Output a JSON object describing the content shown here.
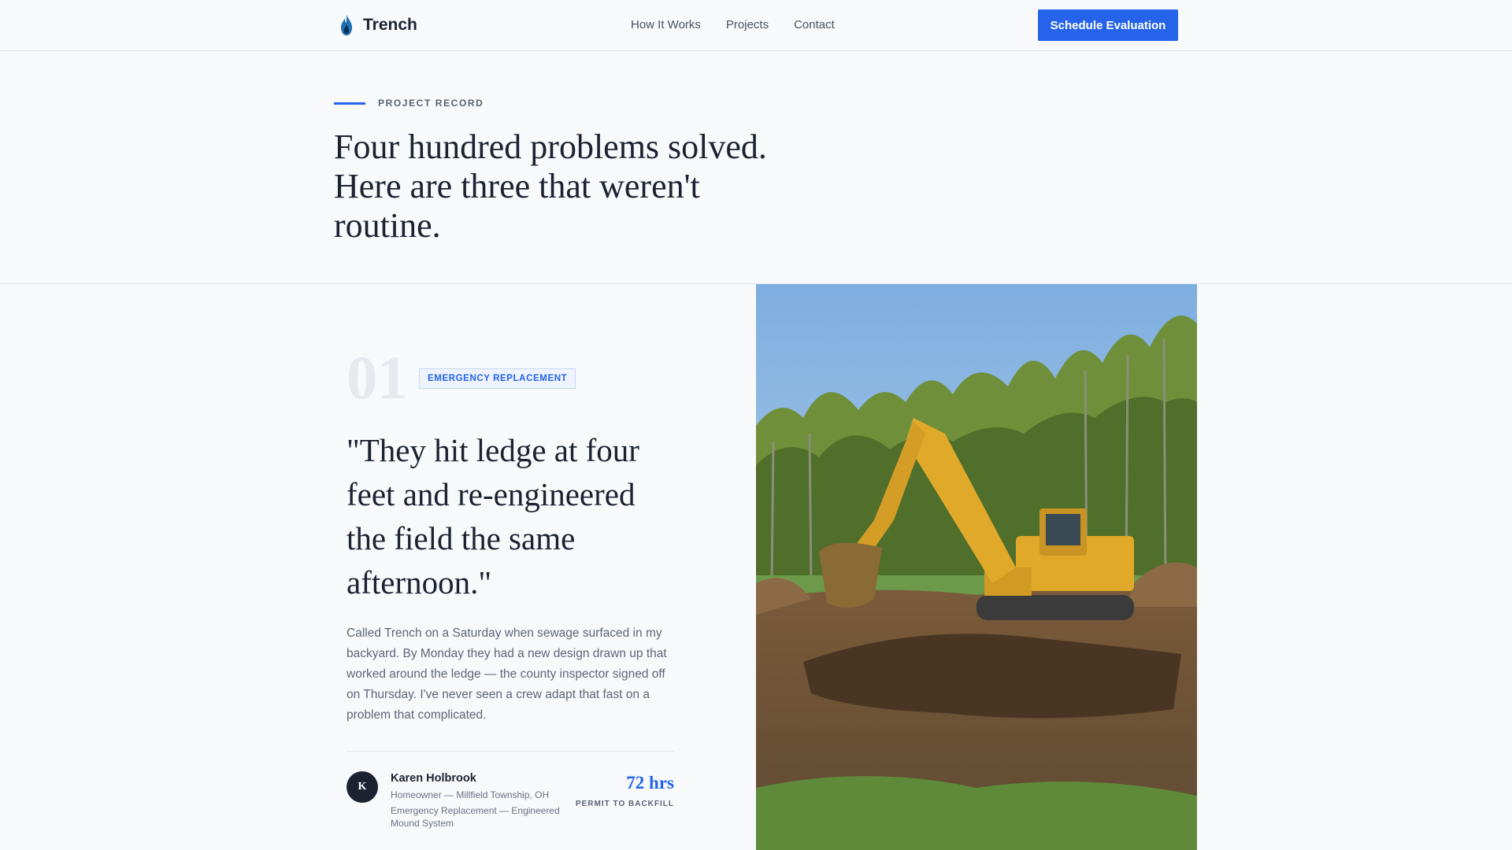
{
  "nav": {
    "brand": "Trench",
    "links": [
      "How It Works",
      "Projects",
      "Contact"
    ],
    "cta": "Schedule Evaluation"
  },
  "hero": {
    "eyebrow": "PROJECT RECORD",
    "title": "Four hundred problems solved. Here are three that weren't routine."
  },
  "case": {
    "number": "01",
    "tag": "EMERGENCY REPLACEMENT",
    "quote": "\"They hit ledge at four feet and re-engineered the field the same afternoon.\"",
    "body": "Called Trench on a Saturday when sewage surfaced in my backyard. By Monday they had a new design drawn up that worked around the ledge — the county inspector signed off on Thursday. I've never seen a crew adapt that fast on a problem that complicated.",
    "author": {
      "initial": "K",
      "name": "Karen Holbrook",
      "role": "Homeowner — Millfield Township, OH",
      "project": "Emergency Replacement — Engineered Mound System"
    },
    "stat": {
      "value": "72 hrs",
      "label": "PERMIT TO BACKFILL"
    }
  },
  "colors": {
    "accent": "#2563eb",
    "text": "#1c2230",
    "background": "#f7f9fb"
  },
  "icons": {
    "brand": "flame-droplet-icon"
  }
}
